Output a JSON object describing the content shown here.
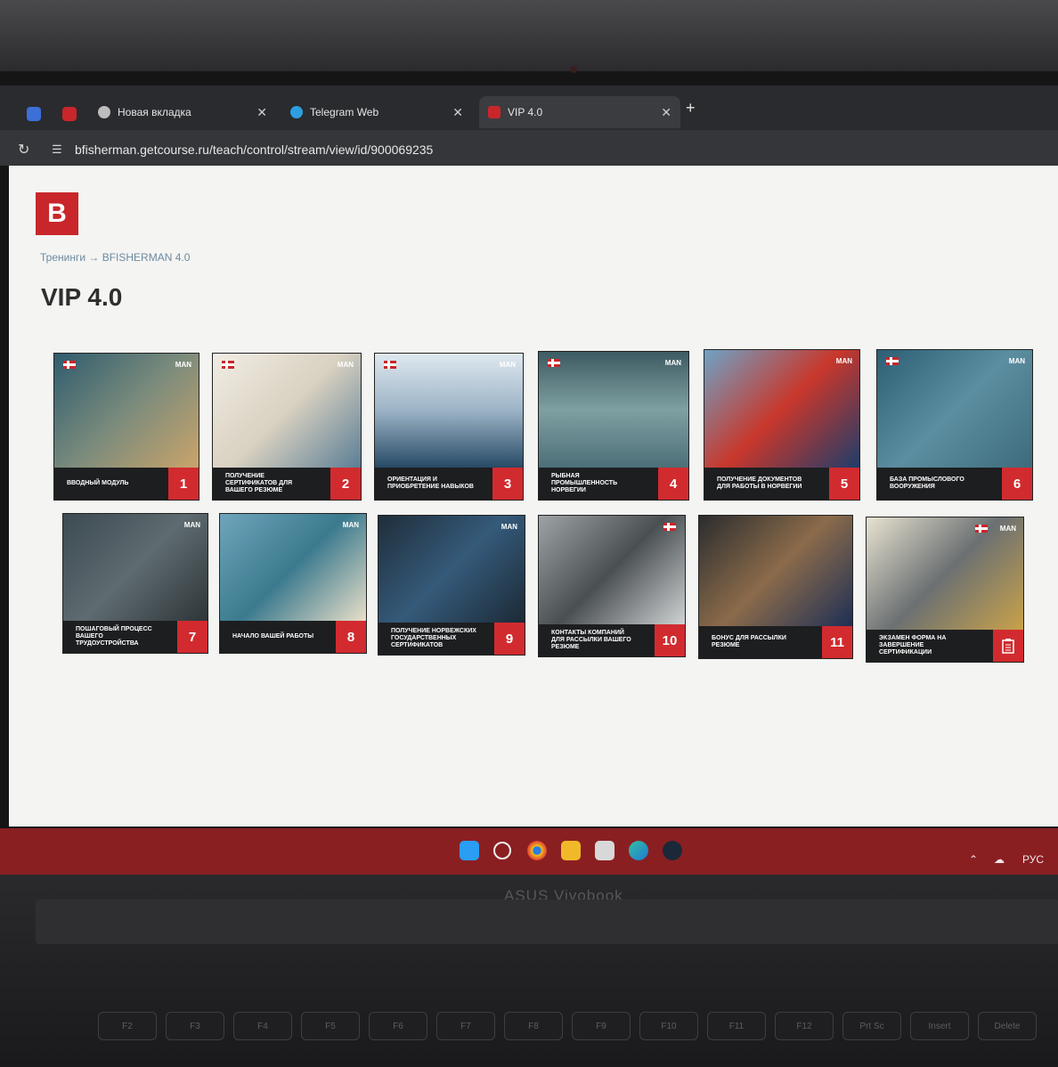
{
  "browser": {
    "tabs": [
      {
        "label": "Новая вкладка"
      },
      {
        "label": "Telegram Web"
      },
      {
        "label": "VIP 4.0"
      }
    ],
    "url": "bfisherman.getcourse.ru/teach/control/stream/view/id/900069235"
  },
  "page": {
    "logo_letter": "B",
    "breadcrumb": "Тренинги → BFISHERMAN 4.0",
    "title": "VIP 4.0"
  },
  "cards": [
    {
      "label": "ВВОДНЫЙ МОДУЛЬ",
      "num": "1",
      "brand": "MAN"
    },
    {
      "label": "ПОЛУЧЕНИЕ СЕРТИФИКАТОВ ДЛЯ ВАШЕГО РЕЗЮМЕ",
      "num": "2",
      "brand": "MAN"
    },
    {
      "label": "ОРИЕНТАЦИЯ И ПРИОБРЕТЕНИЕ НАВЫКОВ",
      "num": "3",
      "brand": "MAN"
    },
    {
      "label": "РЫБНАЯ ПРОМЫШЛЕННОСТЬ НОРВЕГИИ",
      "num": "4",
      "brand": "MAN"
    },
    {
      "label": "ПОЛУЧЕНИЕ ДОКУМЕНТОВ ДЛЯ РАБОТЫ В НОРВЕГИИ",
      "num": "5",
      "brand": "MAN"
    },
    {
      "label": "БАЗА ПРОМЫСЛОВОГО ВООРУЖЕНИЯ",
      "num": "6",
      "brand": "MAN"
    },
    {
      "label": "ПОШАГОВЫЙ ПРОЦЕСС ВАШЕГО ТРУДОУСТРОЙСТВА",
      "num": "7",
      "brand": "MAN"
    },
    {
      "label": "НАЧАЛО ВАШЕЙ РАБОТЫ",
      "num": "8",
      "brand": "MAN"
    },
    {
      "label": "ПОЛУЧЕНИЕ НОРВЕЖСКИХ ГОСУДАРСТВЕННЫХ СЕРТИФИКАТОВ",
      "num": "9",
      "brand": "MAN"
    },
    {
      "label": "КОНТАКТЫ КОМПАНИЙ ДЛЯ РАССЫЛКИ ВАШЕГО РЕЗЮМЕ",
      "num": "10",
      "brand": ""
    },
    {
      "label": "БОНУС ДЛЯ РАССЫЛКИ РЕЗЮМЕ",
      "num": "11",
      "brand": ""
    },
    {
      "label": "ЭКЗАМЕН ФОРМА НА ЗАВЕРШЕНИЕ СЕРТИФИКАЦИИ",
      "num": "",
      "brand": "MAN"
    }
  ],
  "taskbar": {
    "lang": "РУС"
  },
  "laptop": {
    "brand": "ASUS Vivobook"
  },
  "keys": [
    "F2",
    "F3",
    "F4",
    "F5",
    "F6",
    "F7",
    "F8",
    "F9",
    "F10",
    "F11",
    "F12",
    "Prt Sc",
    "Insert",
    "Delete"
  ],
  "colors": {
    "accent": "#d12b2f",
    "tile_band": "#1d1e20",
    "page_bg": "#f4f4f2",
    "taskbar": "#8a1f22"
  }
}
